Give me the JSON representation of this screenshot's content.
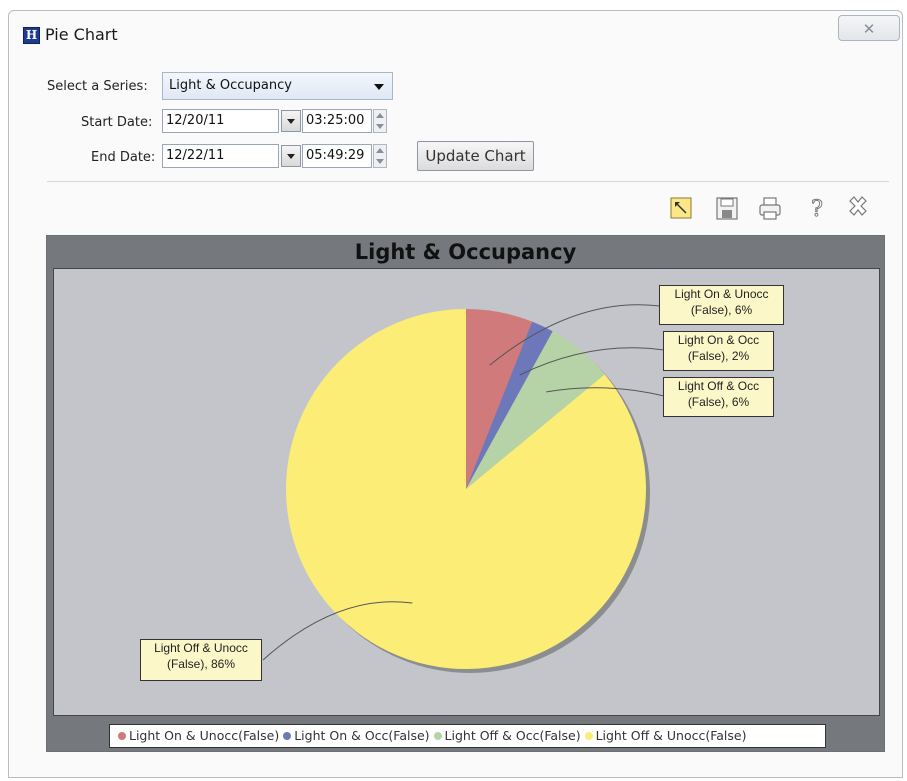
{
  "window": {
    "title": "Pie Chart",
    "app_icon_letter": "H",
    "close_symbol": "✕"
  },
  "form": {
    "series_label": "Select a Series:",
    "series_value": "Light & Occupancy",
    "start_label": "Start Date:",
    "start_date": "12/20/11",
    "start_time": "03:25:00",
    "end_label": "End Date:",
    "end_date": "12/22/11",
    "end_time": "05:49:29",
    "update_button": "Update Chart"
  },
  "toolbar": [
    "zoom-icon",
    "save-icon",
    "print-icon",
    "help-icon",
    "close-icon"
  ],
  "chart_data": {
    "type": "pie",
    "title": "Light & Occupancy",
    "slices": [
      {
        "name": "Light On & Unocc(False)",
        "value": 6,
        "color": "#d07a7c",
        "label_line1": "Light On & Unocc",
        "label_line2": "(False), 6%"
      },
      {
        "name": "Light On & Occ(False)",
        "value": 2,
        "color": "#6d78bb",
        "label_line1": "Light On & Occ",
        "label_line2": "(False), 2%"
      },
      {
        "name": "Light Off & Occ(False)",
        "value": 6,
        "color": "#b6d3a8",
        "label_line1": "Light Off & Occ",
        "label_line2": "(False), 6%"
      },
      {
        "name": "Light Off & Unocc(False)",
        "value": 86,
        "color": "#fbed76",
        "label_line1": "Light Off & Unocc",
        "label_line2": "(False), 86%"
      }
    ],
    "legend_position": "bottom"
  }
}
